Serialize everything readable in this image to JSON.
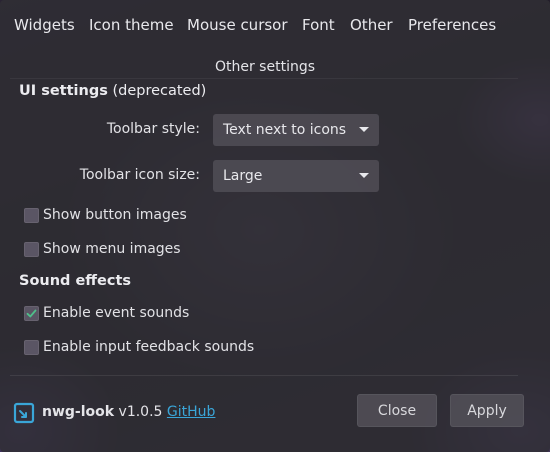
{
  "tabs": [
    {
      "label": "Widgets"
    },
    {
      "label": "Icon theme"
    },
    {
      "label": "Mouse cursor"
    },
    {
      "label": "Font"
    },
    {
      "label": "Other"
    },
    {
      "label": "Preferences"
    }
  ],
  "section_title": "Other settings",
  "ui_settings": {
    "heading": "UI settings",
    "heading_suffix": "(deprecated)",
    "toolbar_style": {
      "label": "Toolbar style:",
      "value": "Text next to icons"
    },
    "toolbar_icon_size": {
      "label": "Toolbar icon size:",
      "value": "Large"
    },
    "show_button_images": {
      "label": "Show button images",
      "checked": false
    },
    "show_menu_images": {
      "label": "Show menu images",
      "checked": false
    }
  },
  "sound_effects": {
    "heading": "Sound effects",
    "enable_event_sounds": {
      "label": "Enable event sounds",
      "checked": true
    },
    "enable_input_feedback_sounds": {
      "label": "Enable input feedback sounds",
      "checked": false
    }
  },
  "footer": {
    "app_name": "nwg-look",
    "version": "v1.0.5",
    "link": "GitHub",
    "logo_icon": "nwg-logo-icon",
    "close_label": "Close",
    "apply_label": "Apply"
  },
  "colors": {
    "accent": "#3aa6d8",
    "check": "#4fbf8a"
  }
}
